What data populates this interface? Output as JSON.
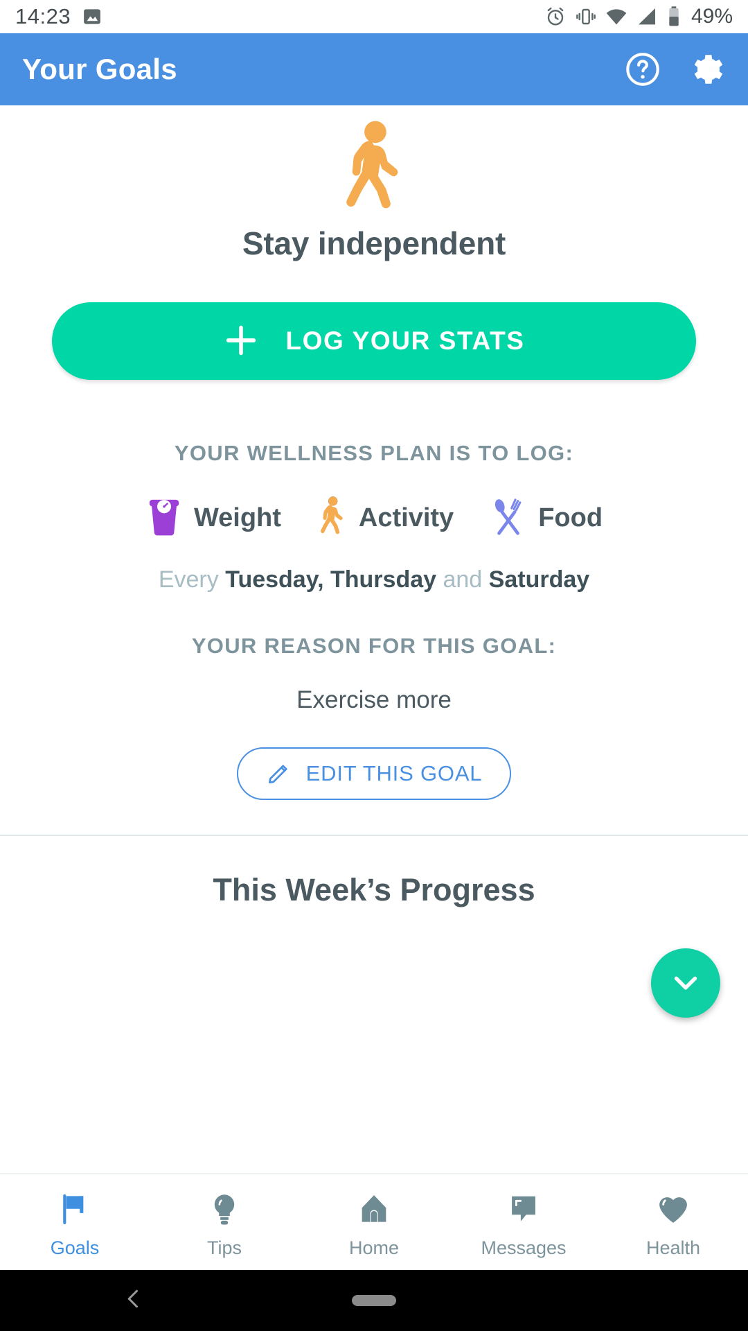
{
  "status_bar": {
    "time": "14:23",
    "battery_percent": "49%",
    "icons": [
      "image-icon",
      "alarm-icon",
      "vibrate-icon",
      "wifi-icon",
      "signal-icon",
      "battery-icon"
    ]
  },
  "app_bar": {
    "title": "Your Goals",
    "help_icon": "help-circle-icon",
    "settings_icon": "gear-icon",
    "background_color": "#4a90e2"
  },
  "hero": {
    "icon": "walking-person-icon",
    "icon_color": "#f5ab4f",
    "title": "Stay independent"
  },
  "cta": {
    "label": "LOG YOUR STATS",
    "icon": "plus-icon",
    "color": "#00d6a6"
  },
  "plan": {
    "heading": "YOUR WELLNESS PLAN IS TO LOG:",
    "items": [
      {
        "label": "Weight",
        "icon": "scale-icon",
        "color": "#9b3fd6"
      },
      {
        "label": "Activity",
        "icon": "walking-person-icon",
        "color": "#f5ab4f"
      },
      {
        "label": "Food",
        "icon": "cutlery-icon",
        "color": "#7b86ea"
      }
    ],
    "schedule_prefix": "Every",
    "schedule_days_1": "Tuesday, Thursday",
    "schedule_conjunction": "and",
    "schedule_days_2": "Saturday"
  },
  "reason": {
    "heading": "YOUR REASON FOR THIS GOAL:",
    "text": "Exercise more"
  },
  "edit_button": {
    "label": "EDIT THIS GOAL",
    "icon": "pencil-icon",
    "color": "#4a90e2"
  },
  "progress": {
    "heading": "This Week’s Progress"
  },
  "fab": {
    "icon": "chevron-down-icon",
    "color": "#0fd0a4"
  },
  "bottom_nav": {
    "active_color": "#3f8fe0",
    "inactive_color": "#7e949d",
    "items": [
      {
        "label": "Goals",
        "icon": "flag-icon",
        "active": true
      },
      {
        "label": "Tips",
        "icon": "lightbulb-icon",
        "active": false
      },
      {
        "label": "Home",
        "icon": "home-icon",
        "active": false
      },
      {
        "label": "Messages",
        "icon": "speech-bubble-icon",
        "active": false
      },
      {
        "label": "Health",
        "icon": "heart-icon",
        "active": false
      }
    ]
  },
  "system_nav": {
    "back_icon": "back-chevron-icon",
    "home_pill": "home-pill-handle"
  }
}
